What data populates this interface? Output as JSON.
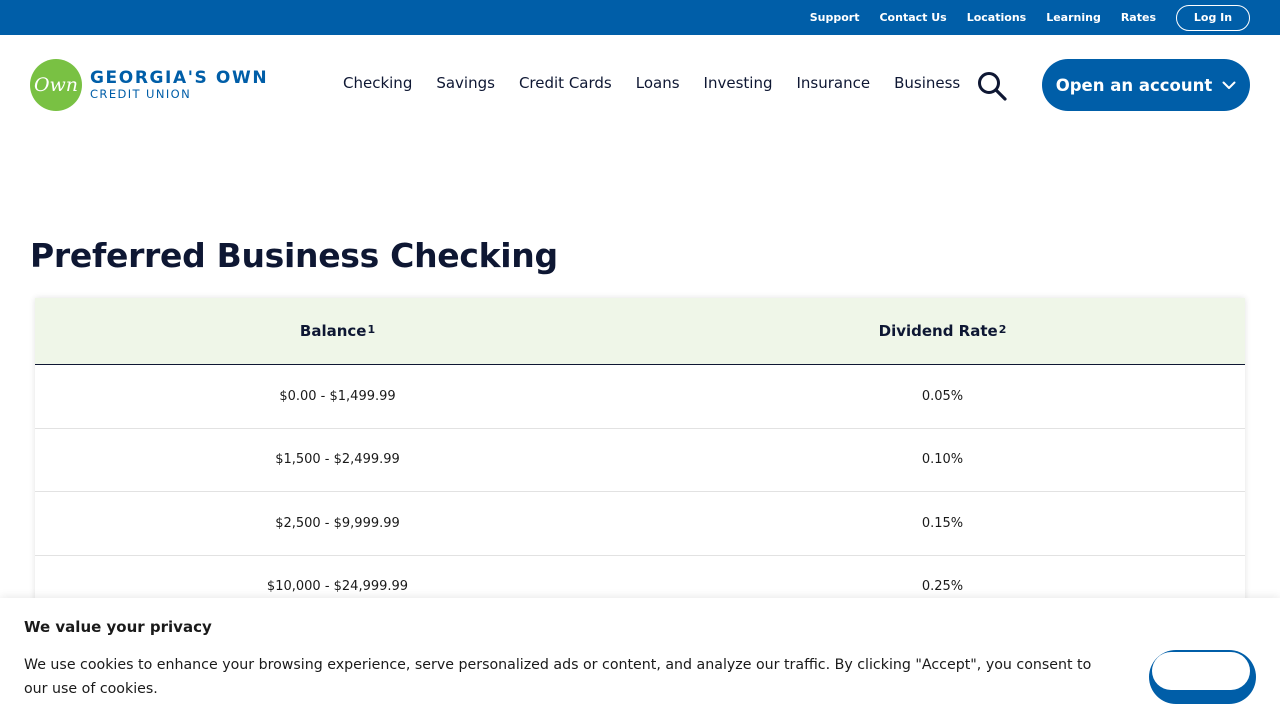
{
  "utility_nav": {
    "links": [
      "Support",
      "Contact Us",
      "Locations",
      "Learning",
      "Rates"
    ],
    "login_label": "Log In"
  },
  "logo": {
    "mark": "Own",
    "line1": "GEORGIA'S OWN",
    "line2": "CREDIT UNION"
  },
  "main_nav": {
    "items": [
      "Checking",
      "Savings",
      "Credit Cards",
      "Loans",
      "Investing",
      "Insurance",
      "Business"
    ],
    "search_icon": "search-icon",
    "cta_label": "Open an account",
    "cta_icon": "chevron-down-icon"
  },
  "page": {
    "title": "Preferred Business Checking"
  },
  "rate_table": {
    "headers": [
      {
        "label": "Balance",
        "sup": "1"
      },
      {
        "label": "Dividend Rate",
        "sup": "2"
      }
    ],
    "rows": [
      {
        "balance": "$0.00 - $1,499.99",
        "rate": "0.05%"
      },
      {
        "balance": "$1,500 - $2,499.99",
        "rate": "0.10%"
      },
      {
        "balance": "$2,500 - $9,999.99",
        "rate": "0.15%"
      },
      {
        "balance": "$10,000 - $24,999.99",
        "rate": "0.25%"
      }
    ]
  },
  "cookie_banner": {
    "title": "We value your privacy",
    "text": "We use cookies to enhance your browsing experience, serve personalized ads or content, and analyze our traffic. By clicking \"Accept\", you consent to our use of cookies."
  },
  "colors": {
    "brand_blue": "#005ea8",
    "brand_green": "#79c143",
    "table_header_bg": "#eff6e8",
    "text_dark": "#0e1733"
  }
}
